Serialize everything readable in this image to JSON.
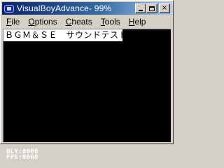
{
  "window": {
    "title": "VisualBoyAdvance- 99%",
    "app_icon": "gameboy-advance-icon",
    "buttons": {
      "minimize": "minimize-icon",
      "maximize": "maximize-icon",
      "close": "×"
    }
  },
  "menubar": {
    "items": [
      {
        "accel": "F",
        "rest": "ile"
      },
      {
        "accel": "O",
        "rest": "ptions"
      },
      {
        "accel": "C",
        "rest": "heats"
      },
      {
        "accel": "T",
        "rest": "ools"
      },
      {
        "accel": "H",
        "rest": "elp"
      }
    ]
  },
  "game": {
    "header": "ＢＧＭ＆ＳＥ　サウンドテスト",
    "dly": "DLY:0000",
    "fps": "FPS:0060"
  },
  "colors": {
    "titlebar_start": "#0a246a",
    "titlebar_end": "#a6caf0",
    "screen_bg": "#000000",
    "header_bg": "#ffffff",
    "chrome": "#d4d0c8"
  }
}
